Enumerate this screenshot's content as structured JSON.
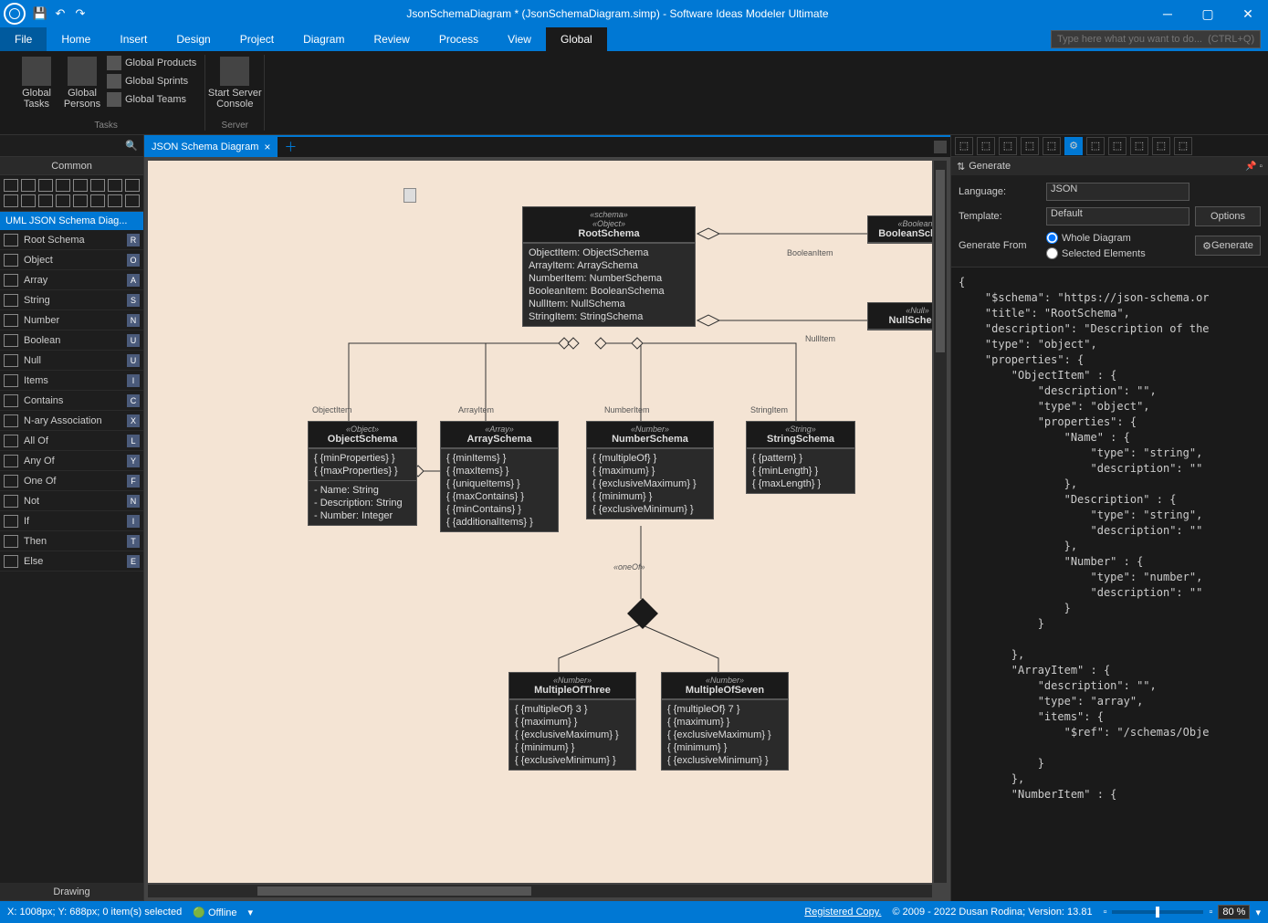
{
  "titlebar": {
    "title": "JsonSchemaDiagram *  (JsonSchemaDiagram.simp)  - Software Ideas Modeler Ultimate"
  },
  "menubar": {
    "tabs": [
      "File",
      "Home",
      "Insert",
      "Design",
      "Project",
      "Diagram",
      "Review",
      "Process",
      "View",
      "Global"
    ],
    "active": "Global",
    "search_placeholder": "Type here what you want to do...  (CTRL+Q)"
  },
  "ribbon": {
    "groups": [
      {
        "label": "Tasks",
        "big": [
          {
            "label": "Global\nTasks"
          },
          {
            "label": "Global\nPersons"
          }
        ],
        "small": [
          "Global Products",
          "Global Sprints",
          "Global Teams"
        ]
      },
      {
        "label": "Server",
        "big": [
          {
            "label": "Start Server\nConsole"
          }
        ]
      }
    ]
  },
  "sidebar": {
    "common": "Common",
    "title": "UML JSON Schema Diag...",
    "items": [
      {
        "label": "Root Schema",
        "key": "R"
      },
      {
        "label": "Object",
        "key": "O"
      },
      {
        "label": "Array",
        "key": "A"
      },
      {
        "label": "String",
        "key": "S"
      },
      {
        "label": "Number",
        "key": "N"
      },
      {
        "label": "Boolean",
        "key": "U"
      },
      {
        "label": "Null",
        "key": "U"
      },
      {
        "label": "Items",
        "key": "I"
      },
      {
        "label": "Contains",
        "key": "C"
      },
      {
        "label": "N-ary Association",
        "key": "X"
      },
      {
        "label": "All Of",
        "key": "L"
      },
      {
        "label": "Any Of",
        "key": "Y"
      },
      {
        "label": "One Of",
        "key": "F"
      },
      {
        "label": "Not",
        "key": "N"
      },
      {
        "label": "If",
        "key": "I"
      },
      {
        "label": "Then",
        "key": "T"
      },
      {
        "label": "Else",
        "key": "E"
      }
    ],
    "drawing": "Drawing"
  },
  "tab": {
    "label": "JSON Schema Diagram"
  },
  "nodes": {
    "root": {
      "stereo1": "«schema»",
      "stereo2": "«Object»",
      "name": "RootSchema",
      "rows": [
        "ObjectItem: ObjectSchema",
        "ArrayItem: ArraySchema",
        "NumberItem: NumberSchema",
        "BooleanItem: BooleanSchema",
        "NullItem: NullSchema",
        "StringItem: StringSchema"
      ]
    },
    "bool": {
      "stereo": "«Boolean»",
      "name": "BooleanSchema"
    },
    "null": {
      "stereo": "«Null»",
      "name": "NullSchema"
    },
    "obj": {
      "stereo": "«Object»",
      "name": "ObjectSchema",
      "rows": [
        "{ {minProperties}  }",
        "{ {maxProperties}  }"
      ],
      "rows2": [
        "- Name: String",
        "- Description: String",
        "- Number: Integer"
      ]
    },
    "arr": {
      "stereo": "«Array»",
      "name": "ArraySchema",
      "rows": [
        "{ {minItems}  }",
        "{ {maxItems}  }",
        "{ {uniqueItems}  }",
        "{ {maxContains}  }",
        "{ {minContains}  }",
        "{ {additionalItems}  }"
      ]
    },
    "num": {
      "stereo": "«Number»",
      "name": "NumberSchema",
      "rows": [
        "{ {multipleOf}  }",
        "{ {maximum}  }",
        "{ {exclusiveMaximum}  }",
        "{ {minimum}  }",
        "{ {exclusiveMinimum}  }"
      ]
    },
    "str": {
      "stereo": "«String»",
      "name": "StringSchema",
      "rows": [
        "{ {pattern}  }",
        "{ {minLength}  }",
        "{ {maxLength}  }"
      ]
    },
    "m3": {
      "stereo": "«Number»",
      "name": "MultipleOfThree",
      "rows": [
        "{ {multipleOf} 3 }",
        "{ {maximum}  }",
        "{ {exclusiveMaximum}  }",
        "{ {minimum}  }",
        "{ {exclusiveMinimum}  }"
      ]
    },
    "m7": {
      "stereo": "«Number»",
      "name": "MultipleOfSeven",
      "rows": [
        "{ {multipleOf} 7 }",
        "{ {maximum}  }",
        "{ {exclusiveMaximum}  }",
        "{ {minimum}  }",
        "{ {exclusiveMinimum}  }"
      ]
    }
  },
  "labels": {
    "booleanItem": "BooleanItem",
    "nullItem": "NullItem",
    "objectItem": "ObjectItem",
    "arrayItem": "ArrayItem",
    "numberItem": "NumberItem",
    "stringItem": "StringItem",
    "oneOf": "«oneOf»"
  },
  "generate": {
    "title": "Generate",
    "language_label": "Language:",
    "language": "JSON",
    "template_label": "Template:",
    "template": "Default",
    "from_label": "Generate From",
    "r1": "Whole Diagram",
    "r2": "Selected Elements",
    "options": "Options",
    "generate": "Generate"
  },
  "code": "{\n    \"$schema\": \"https://json-schema.or\n    \"title\": \"RootSchema\",\n    \"description\": \"Description of the\n    \"type\": \"object\",\n    \"properties\": {\n        \"ObjectItem\" : {\n            \"description\": \"\",\n            \"type\": \"object\",\n            \"properties\": {\n                \"Name\" : {\n                    \"type\": \"string\",\n                    \"description\": \"\"\n                },\n                \"Description\" : {\n                    \"type\": \"string\",\n                    \"description\": \"\"\n                },\n                \"Number\" : {\n                    \"type\": \"number\",\n                    \"description\": \"\"\n                }\n            }\n\n        },\n        \"ArrayItem\" : {\n            \"description\": \"\",\n            \"type\": \"array\",\n            \"items\": {\n                \"$ref\": \"/schemas/Obje\n\n            }\n        },\n        \"NumberItem\" : {",
  "statusbar": {
    "pos": "X: 1008px; Y: 688px; 0 item(s) selected",
    "offline": "Offline",
    "copy": "Registered Copy.",
    "copyright": "© 2009 - 2022 Dusan Rodina; Version: 13.81",
    "zoom": "80 %"
  }
}
